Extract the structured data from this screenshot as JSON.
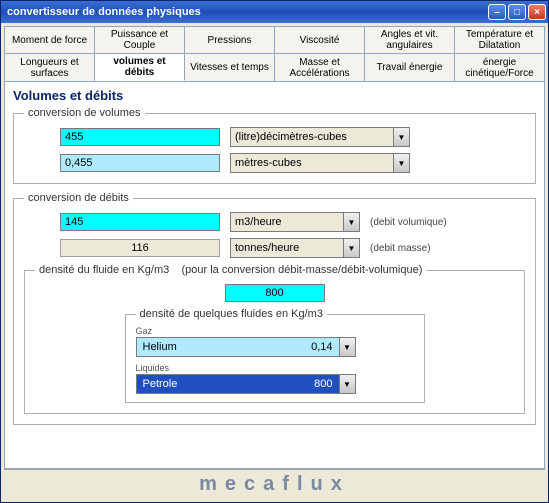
{
  "window": {
    "title": "convertisseur de données physiques"
  },
  "tabs_row1": [
    "Moment de force",
    "Puissance et Couple",
    "Pressions",
    "Viscosité",
    "Angles et vit. angulaires",
    "Température et Dilatation"
  ],
  "tabs_row2": [
    "Longueurs et surfaces",
    "volumes et débits",
    "Vitesses et temps",
    "Masse et Accélérations",
    "Travail énergie",
    "énergie cinétique/Force"
  ],
  "active_tab_index": 1,
  "panel": {
    "title": "Volumes et débits",
    "volumes": {
      "legend": "conversion de volumes",
      "input_value": "455",
      "input_unit": "(litre)décimètres-cubes",
      "output_value": "0,455",
      "output_unit": "mètres-cubes"
    },
    "debits": {
      "legend": "conversion de débits",
      "vol_value": "145",
      "vol_unit": "m3/heure",
      "vol_side": "(debit volumique)",
      "mass_value": "116",
      "mass_unit": "tonnes/heure",
      "mass_side": "(debit masse)"
    },
    "density": {
      "legend": "densité du fluide en Kg/m3",
      "note": "(pour la conversion débit-masse/débit-volumique)",
      "value": "800",
      "fluids_legend": "densité de quelques fluides en Kg/m3",
      "gas_label": "Gaz",
      "gas_name": "Helium",
      "gas_density": "0,14",
      "liq_label": "Liquides",
      "liq_name": "Petrole",
      "liq_density": "800"
    }
  },
  "footer": "mecaflux"
}
